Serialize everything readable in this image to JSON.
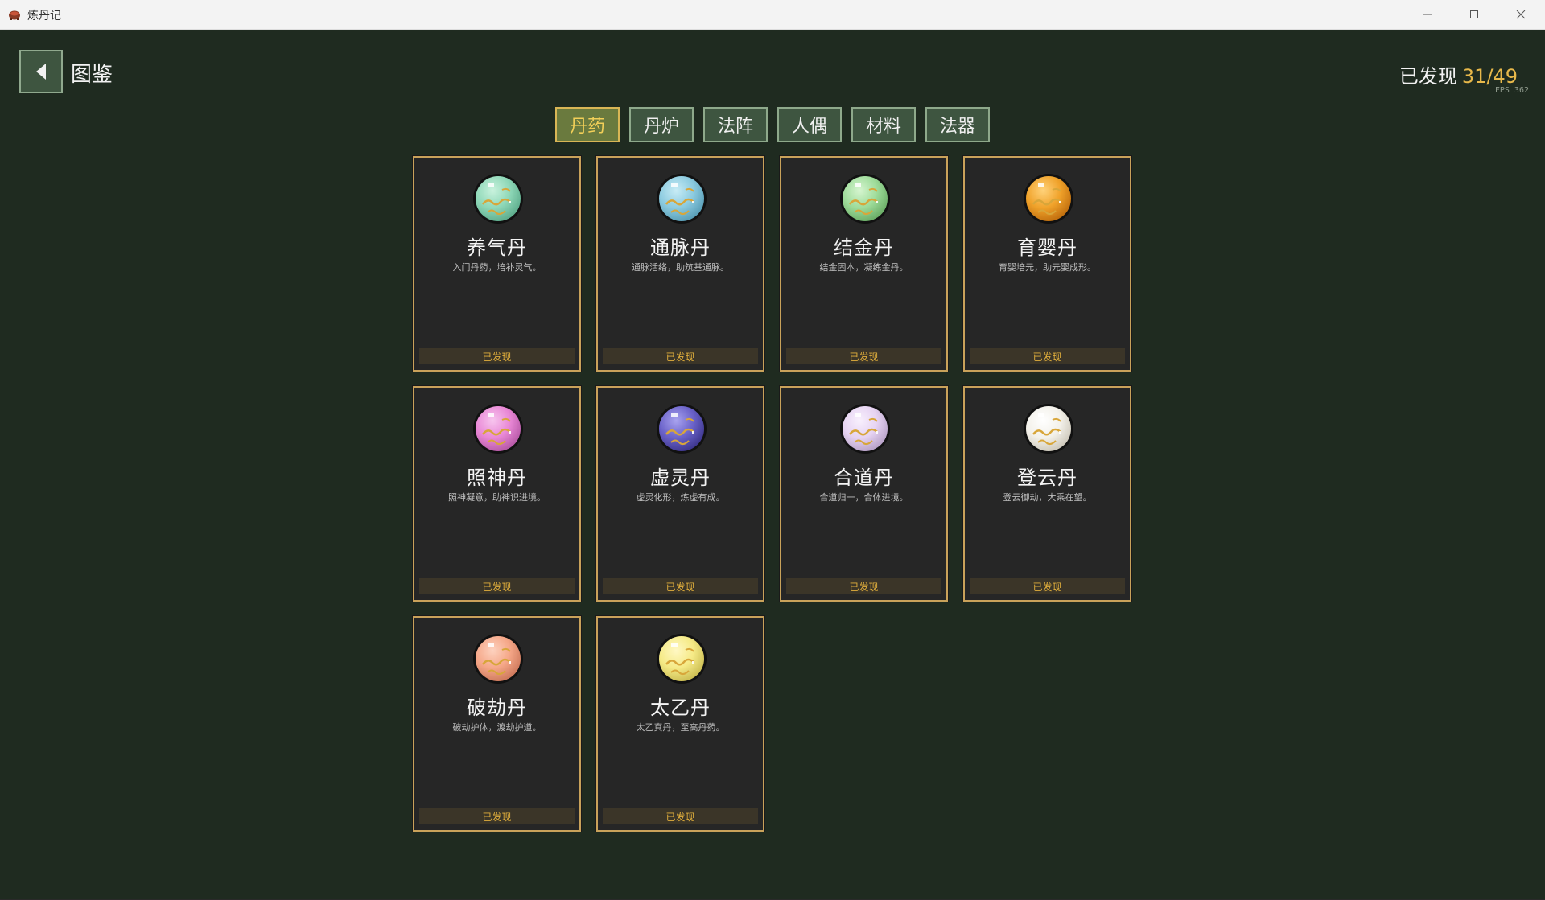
{
  "window": {
    "title": "炼丹记",
    "minimize_icon": "minimize-icon",
    "maximize_icon": "maximize-icon",
    "close_icon": "close-icon"
  },
  "header": {
    "back_icon": "back-arrow-icon",
    "page_title": "图鉴",
    "discovered_label": "已发现",
    "discovered_count": "31/49",
    "fps": "FPS 362"
  },
  "tabs": [
    {
      "label": "丹药",
      "active": true
    },
    {
      "label": "丹炉",
      "active": false
    },
    {
      "label": "法阵",
      "active": false
    },
    {
      "label": "人偶",
      "active": false
    },
    {
      "label": "材料",
      "active": false
    },
    {
      "label": "法器",
      "active": false
    }
  ],
  "cards": [
    {
      "name": "养气丹",
      "desc": "入门丹药，培补灵气。",
      "status": "已发现",
      "orb_color": "#8fd8b8",
      "orb_dark": "#5fae8e",
      "orb_light": "#c9f2dd"
    },
    {
      "name": "通脉丹",
      "desc": "通脉活络，助筑基通脉。",
      "status": "已发现",
      "orb_color": "#8ccbe0",
      "orb_dark": "#5a9fb8",
      "orb_light": "#c8ecf5"
    },
    {
      "name": "结金丹",
      "desc": "结金固本，凝练金丹。",
      "status": "已发现",
      "orb_color": "#9edc9a",
      "orb_dark": "#6cae68",
      "orb_light": "#d6f5d0"
    },
    {
      "name": "育婴丹",
      "desc": "育婴培元，助元婴成形。",
      "status": "已发现",
      "orb_color": "#f0a22a",
      "orb_dark": "#c2700f",
      "orb_light": "#ffd27a"
    },
    {
      "name": "照神丹",
      "desc": "照神凝意，助神识进境。",
      "status": "已发现",
      "orb_color": "#e988d6",
      "orb_dark": "#b85aa8",
      "orb_light": "#f7c5ee"
    },
    {
      "name": "虚灵丹",
      "desc": "虚灵化形，炼虚有成。",
      "status": "已发现",
      "orb_color": "#6a62c9",
      "orb_dark": "#3f3890",
      "orb_light": "#a9a3ef"
    },
    {
      "name": "合道丹",
      "desc": "合道归一，合体进境。",
      "status": "已发现",
      "orb_color": "#e6d3f2",
      "orb_dark": "#b9a3c9",
      "orb_light": "#f8f0fd"
    },
    {
      "name": "登云丹",
      "desc": "登云御劫，大乘在望。",
      "status": "已发现",
      "orb_color": "#f3f1ea",
      "orb_dark": "#cfcabd",
      "orb_light": "#ffffff"
    },
    {
      "name": "破劫丹",
      "desc": "破劫护体，渡劫护道。",
      "status": "已发现",
      "orb_color": "#f5a788",
      "orb_dark": "#cf7a5d",
      "orb_light": "#fdd2bf"
    },
    {
      "name": "太乙丹",
      "desc": "太乙真丹，至高丹药。",
      "status": "已发现",
      "orb_color": "#f5ea86",
      "orb_dark": "#cdbf55",
      "orb_light": "#fff8c4"
    }
  ],
  "colors": {
    "background": "#1f2b20",
    "card_border": "#c9a25a",
    "accent_gold": "#e7b84a",
    "tab_bg": "#3e5540"
  }
}
